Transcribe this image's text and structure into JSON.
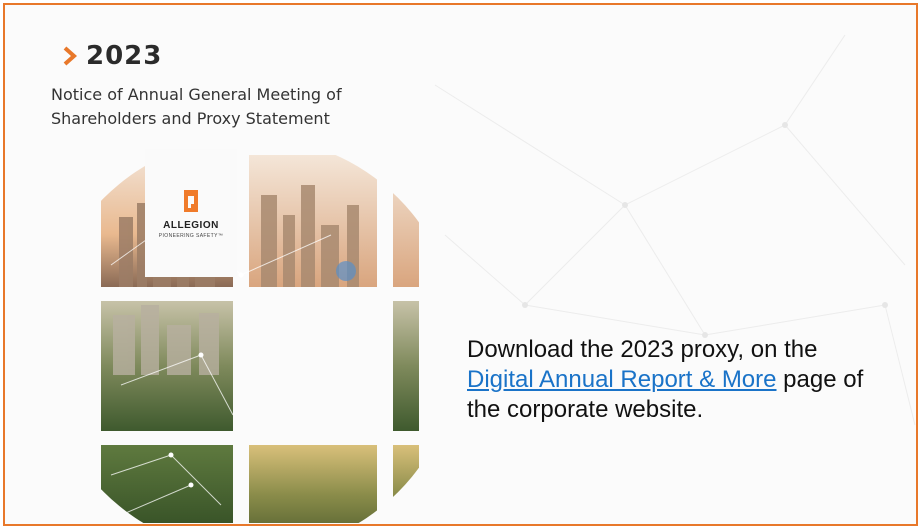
{
  "header": {
    "year": "2023",
    "subtitle_line1": "Notice of Annual General Meeting of",
    "subtitle_line2": "Shareholders and Proxy Statement",
    "chevron_icon": "chevron-right-icon",
    "accent_color": "#e8782a"
  },
  "cover": {
    "brand_name": "ALLEGION",
    "brand_tagline": "PIONEERING SAFETY™",
    "logo_color": "#f07b2a",
    "images": [
      "city-skyline-tile",
      "city-towers-tile",
      "city-edge-tile",
      "buildings-tile",
      "trees-tile",
      "forest-tile",
      "tree-lined-road-tile",
      "road-edge-tile"
    ]
  },
  "message": {
    "text_before": "Download the 2023 proxy, on the ",
    "link_text": "Digital Annual Report & More",
    "text_after": " page of the corporate website.",
    "link_color": "#1a73c8"
  }
}
